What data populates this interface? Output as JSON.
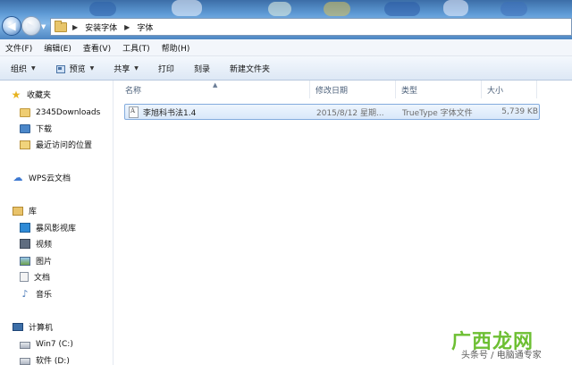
{
  "address_bar": {
    "breadcrumbs": [
      "安装字体",
      "字体"
    ]
  },
  "menu": [
    "文件(F)",
    "编辑(E)",
    "查看(V)",
    "工具(T)",
    "帮助(H)"
  ],
  "toolbar": {
    "organize": "组织",
    "preview": "预览",
    "share": "共享",
    "print": "打印",
    "burn": "刻录",
    "new_folder": "新建文件夹"
  },
  "sidebar": {
    "favorites": "收藏夹",
    "fav_items": [
      "2345Downloads",
      "下载",
      "最近访问的位置"
    ],
    "wps": "WPS云文档",
    "library": "库",
    "lib_items": [
      "暴风影视库",
      "视频",
      "图片",
      "文档",
      "音乐"
    ],
    "computer": "计算机",
    "drives": [
      "Win7 (C:)",
      "软件 (D:)"
    ]
  },
  "columns": {
    "name": "名称",
    "modified": "修改日期",
    "type": "类型",
    "size": "大小"
  },
  "files": [
    {
      "name": "李旭科书法1.4",
      "modified": "2015/8/12 星期...",
      "type": "TrueType 字体文件",
      "size": "5,739 KB"
    }
  ],
  "watermark": {
    "logo": "广西龙网",
    "caption": "头条号 / 电脑通专家"
  },
  "colors": {
    "selection_border": "#84acdd",
    "selection_fill": "#d9e8fa",
    "header_text": "#4c607a"
  }
}
